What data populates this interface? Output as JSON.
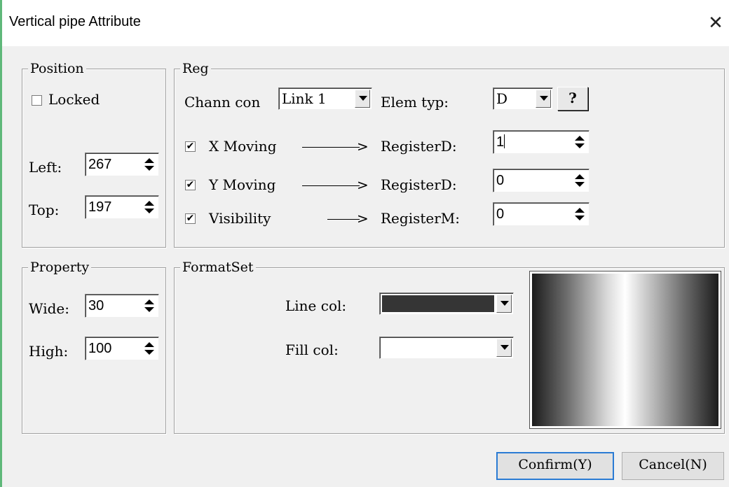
{
  "window": {
    "title": "Vertical pipe Attribute",
    "close_glyph": "✕"
  },
  "position": {
    "legend": "Position",
    "locked_label": "Locked",
    "locked_checked": false,
    "left_label": "Left:",
    "left_value": "267",
    "top_label": "Top:",
    "top_value": "197"
  },
  "reg": {
    "legend": "Reg",
    "chann_label": "Chann con",
    "chann_value": "Link 1",
    "elem_label": "Elem typ:",
    "elem_value": "D",
    "help_label": "?",
    "rows": [
      {
        "label": "X Moving",
        "checked": true,
        "target": "RegisterD:",
        "value": "1"
      },
      {
        "label": "Y Moving",
        "checked": true,
        "target": "RegisterD:",
        "value": "0"
      },
      {
        "label": "Visibility",
        "checked": true,
        "target": "RegisterM:",
        "value": "0"
      }
    ],
    "arrow_head": ">"
  },
  "property": {
    "legend": "Property",
    "wide_label": "Wide:",
    "wide_value": "30",
    "high_label": "High:",
    "high_value": "100"
  },
  "format": {
    "legend": "FormatSet",
    "line_label": "Line col:",
    "line_color": "#353535",
    "fill_label": "Fill col:",
    "fill_color": "#ffffff"
  },
  "buttons": {
    "confirm": "Confirm(Y)",
    "cancel": "Cancel(N)"
  },
  "colors": {
    "accent": "#2a7bd4",
    "window_border": "#5fb87a"
  }
}
